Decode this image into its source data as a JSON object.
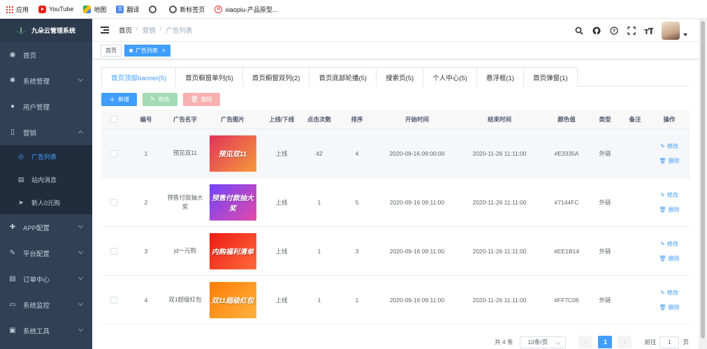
{
  "bookmarks": [
    {
      "label": "应用",
      "icon": "apps-grid-icon"
    },
    {
      "label": "YouTube",
      "icon": "youtube-icon"
    },
    {
      "label": "地图",
      "icon": "maps-icon"
    },
    {
      "label": "翻译",
      "icon": "translate-icon"
    },
    {
      "label": "",
      "icon": "globe-icon"
    },
    {
      "label": "新标签页",
      "icon": "globe-icon"
    },
    {
      "label": "xiaopiu-产品原型...",
      "icon": "xiaopiu-icon"
    }
  ],
  "sidebar": {
    "title": "九朵云管理系统",
    "items": [
      {
        "label": "首页",
        "icon": "dashboard-icon",
        "glyph": "◉",
        "arrow": false
      },
      {
        "label": "系统管理",
        "icon": "gear-icon",
        "glyph": "✱",
        "arrow": true
      },
      {
        "label": "用户管理",
        "icon": "user-icon",
        "glyph": "●",
        "arrow": false
      },
      {
        "label": "营销",
        "icon": "book-icon",
        "glyph": "▯",
        "arrow": "up"
      }
    ],
    "submenu": [
      {
        "label": "广告列表",
        "icon": "eye-icon",
        "glyph": "◎",
        "active": true
      },
      {
        "label": "站内消息",
        "icon": "document-icon",
        "glyph": "▤",
        "active": false
      },
      {
        "label": "新人0元购",
        "icon": "send-icon",
        "glyph": "➤",
        "active": false
      }
    ],
    "items_after": [
      {
        "label": "APP配置",
        "icon": "plus-circle-icon",
        "glyph": "✚",
        "arrow": true
      },
      {
        "label": "平台配置",
        "icon": "edit-icon",
        "glyph": "✎",
        "arrow": true
      },
      {
        "label": "订单中心",
        "icon": "list-icon",
        "glyph": "▤",
        "arrow": true
      },
      {
        "label": "系统监控",
        "icon": "monitor-icon",
        "glyph": "▭",
        "arrow": true
      },
      {
        "label": "系统工具",
        "icon": "toolbox-icon",
        "glyph": "▣",
        "arrow": true
      }
    ]
  },
  "navbar": {
    "breadcrumb": [
      "首页",
      "营销",
      "广告列表"
    ]
  },
  "tags": [
    {
      "label": "首页",
      "active": false
    },
    {
      "label": "广告列表",
      "active": true
    }
  ],
  "tabs": [
    {
      "label": "首页顶部banner(5)",
      "active": true
    },
    {
      "label": "首页橱窗单列(5)",
      "active": false
    },
    {
      "label": "首页橱窗双列(2)",
      "active": false
    },
    {
      "label": "首页底部轮播(5)",
      "active": false
    },
    {
      "label": "搜索页(5)",
      "active": false
    },
    {
      "label": "个人中心(5)",
      "active": false
    },
    {
      "label": "悬浮框(1)",
      "active": false
    },
    {
      "label": "首页弹窗(1)",
      "active": false
    }
  ],
  "toolbar": {
    "add": "新增",
    "edit": "修改",
    "delete": "删除"
  },
  "table": {
    "headers": [
      "编号",
      "广告名字",
      "广告图片",
      "上线/下线",
      "点击次数",
      "排序",
      "开始时间",
      "结束时间",
      "颜色值",
      "类型",
      "备注",
      "操作"
    ],
    "op_edit": "修改",
    "op_delete": "删除",
    "rows": [
      {
        "no": "1",
        "name": "预见双11",
        "img_text": "预见双11",
        "color": "#E3335A",
        "color2": "#f59a3b",
        "status": "上线",
        "clicks": "42",
        "sort": "4",
        "start": "2020-09-16 09:00:00",
        "end": "2020-11-26 11:11:00",
        "colorval": "#E3335A",
        "type": "外链",
        "note": "",
        "hl": true
      },
      {
        "no": "2",
        "name": "预售付款抽大奖",
        "img_text": "预售付款抽大奖",
        "color": "#7144FC",
        "color2": "#e24aa8",
        "status": "上线",
        "clicks": "1",
        "sort": "5",
        "start": "2020-09-16 09:11:00",
        "end": "2020-11-26 11:11:00",
        "colorval": "#7144FC",
        "type": "外链",
        "note": "",
        "hl": false
      },
      {
        "no": "3",
        "name": "jd一元购",
        "img_text": "内购福利清单",
        "color": "#EE1B14",
        "color2": "#ff6a3c",
        "status": "上线",
        "clicks": "1",
        "sort": "3",
        "start": "2020-09-16 09:11:00",
        "end": "2020-11-26 11:11:00",
        "colorval": "#EE1B14",
        "type": "外链",
        "note": "",
        "hl": false
      },
      {
        "no": "4",
        "name": "双1超级红包",
        "img_text": "双11超级红包",
        "color": "#FF7C06",
        "color2": "#ffb23f",
        "status": "上线",
        "clicks": "1",
        "sort": "1",
        "start": "2020-09-16 09:11:00",
        "end": "2020-11-26 11:11:00",
        "colorval": "#FF7C06",
        "type": "外链",
        "note": "",
        "hl": false
      }
    ]
  },
  "pager": {
    "total": "共 4 条",
    "size": "10条/页",
    "page": "1",
    "goto_prefix": "前往",
    "goto_value": "1",
    "goto_suffix": "页"
  },
  "colors": {
    "accent": "#409eff",
    "sidebar": "#304156",
    "sidebar_dark": "#1f2d3d"
  }
}
